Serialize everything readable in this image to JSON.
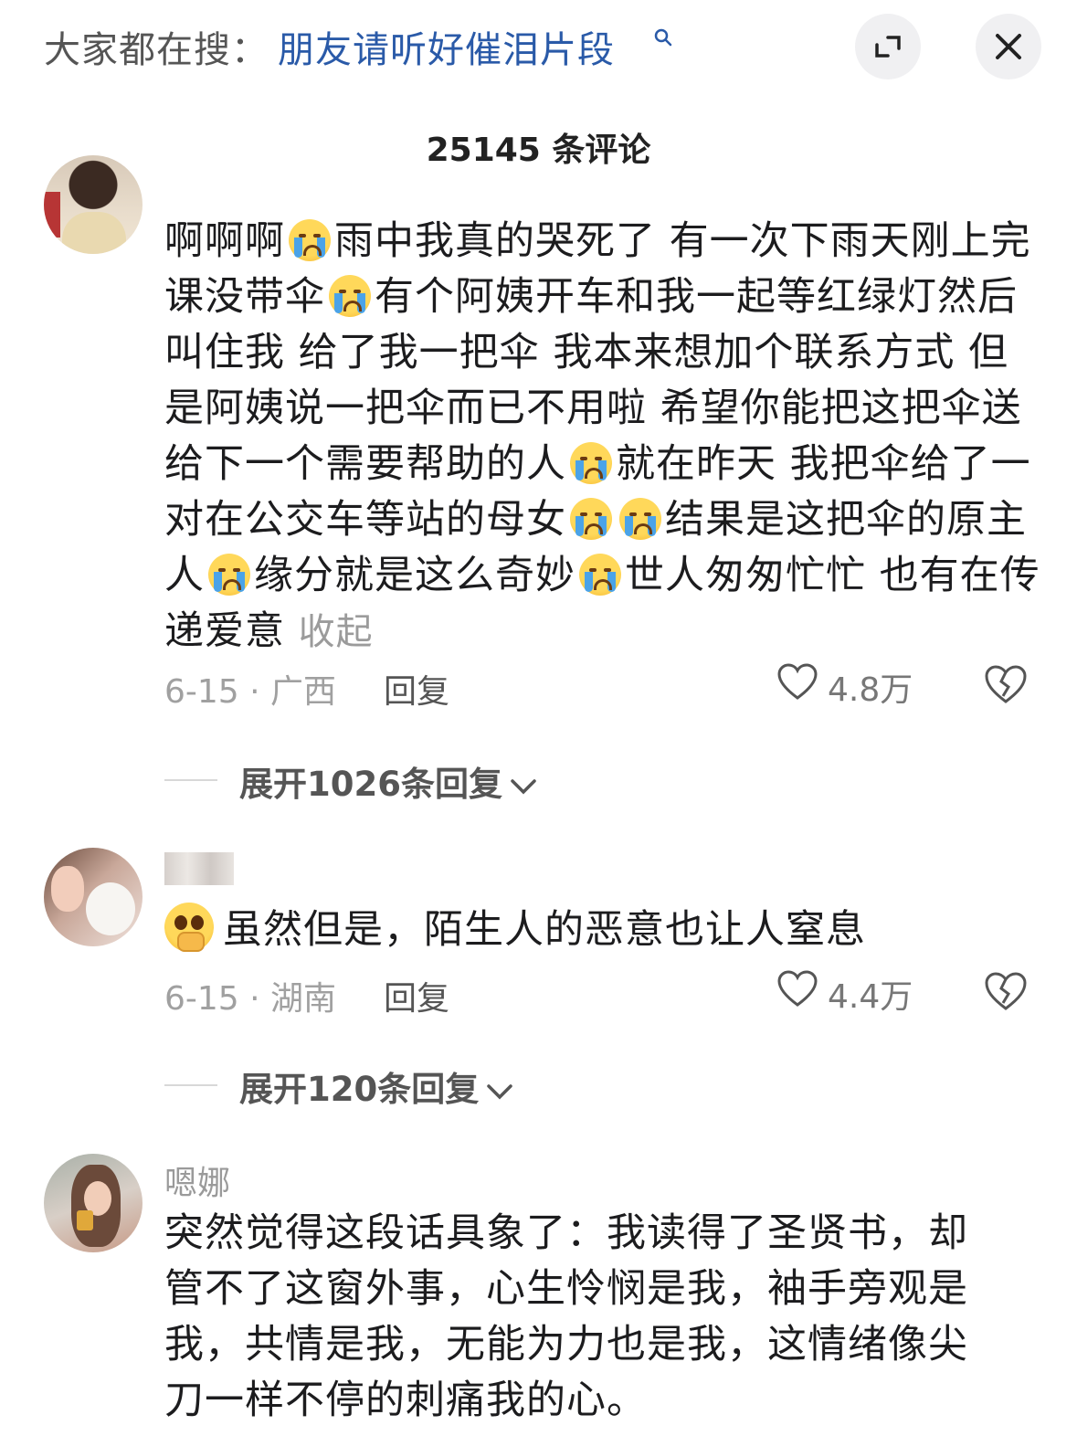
{
  "header": {
    "search_prefix": "大家都在搜：",
    "search_query": "朋友请听好催泪片段",
    "expand_icon": "expand-icon",
    "close_icon": "close-icon"
  },
  "comment_count": "25145 条评论",
  "comments": [
    {
      "text_segments": [
        "啊啊啊",
        "雨中我真的哭死了 有一次下雨天刚上完课没带伞",
        "有个阿姨开车和我一起等红绿灯然后叫住我 给了我一把伞 我本来想加个联系方式 但是阿姨说一把伞而已不用啦 希望你能把这把伞送给下一个需要帮助的人",
        "就在昨天 我把伞给了一对在公交车等站的母女",
        "结果是这把伞的原主人",
        "缘分就是这么奇妙",
        "世人匆匆忙忙 也有在传递爱意 "
      ],
      "collapse_label": "收起",
      "date_location": "6-15 · 广西",
      "reply_label": "回复",
      "likes": "4.8万",
      "expand_replies": "展开1026条回复"
    },
    {
      "text": "虽然但是，陌生人的恶意也让人窒息",
      "date_location": "6-15 · 湖南",
      "reply_label": "回复",
      "likes": "4.4万",
      "expand_replies": "展开120条回复"
    },
    {
      "username": "嗯娜",
      "text": "突然觉得这段话具象了：我读得了圣贤书，却管不了这窗外事，心生怜悯是我，袖手旁观是我，共情是我，无能为力也是我，这情绪像尖刀一样不停的刺痛我的心。"
    }
  ],
  "icons": {
    "crying_emoji": "loudly-crying-face-icon",
    "pleading_emoji": "face-holding-back-tears-icon",
    "like": "heart-icon",
    "dislike": "broken-heart-icon",
    "chevron": "chevron-down-icon"
  },
  "colors": {
    "search_link": "#2a5aa8",
    "meta_gray": "#a0a0a0",
    "text": "#1c1c1e"
  }
}
